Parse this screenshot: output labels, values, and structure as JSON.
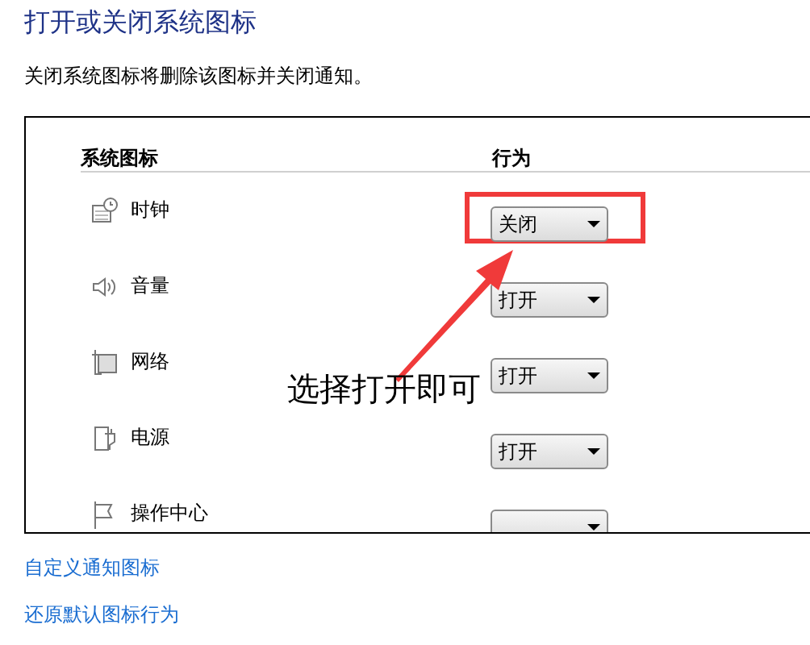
{
  "title": "打开或关闭系统图标",
  "description": "关闭系统图标将删除该图标并关闭通知。",
  "table": {
    "columns": [
      "系统图标",
      "行为"
    ],
    "rows": [
      {
        "name": "时钟",
        "value": "关闭",
        "highlighted": true
      },
      {
        "name": "音量",
        "value": "打开",
        "highlighted": false
      },
      {
        "name": "网络",
        "value": "打开",
        "highlighted": false
      },
      {
        "name": "电源",
        "value": "打开",
        "highlighted": false
      },
      {
        "name": "操作中心",
        "highlighted": false
      }
    ]
  },
  "annotation": {
    "text": "选择打开即可"
  },
  "links": [
    "自定义通知图标",
    "还原默认图标行为"
  ]
}
